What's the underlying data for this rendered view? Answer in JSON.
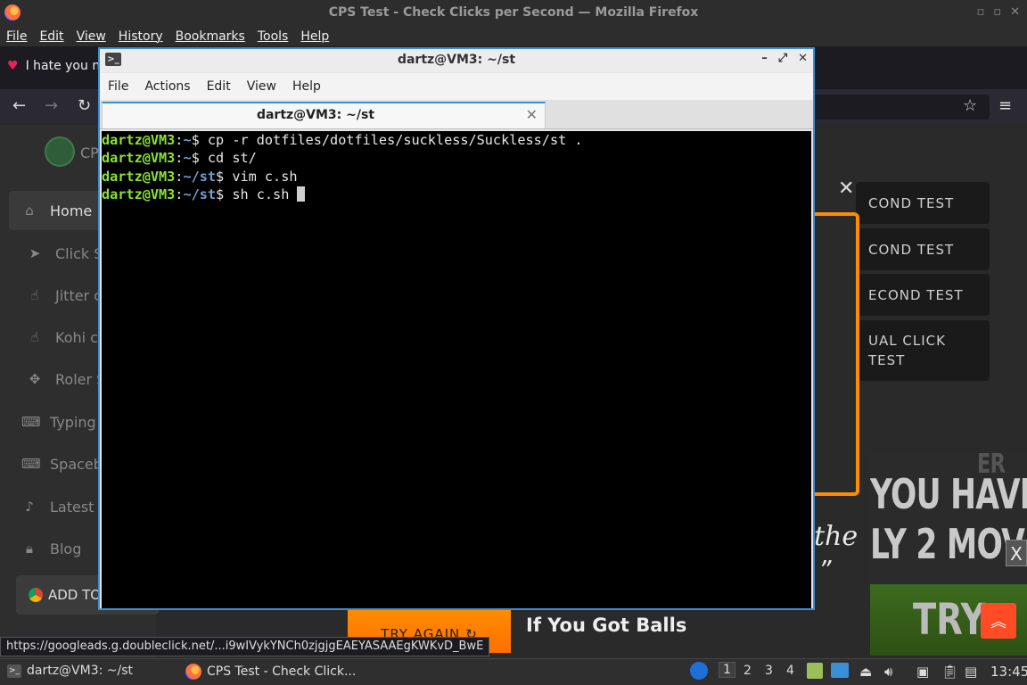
{
  "firefox": {
    "window_title": "CPS Test - Check Clicks per Second — Mozilla Firefox",
    "menu": [
      "File",
      "Edit",
      "View",
      "History",
      "Bookmarks",
      "Tools",
      "Help"
    ],
    "tab_label": "I hate you n"
  },
  "site": {
    "logo_text": "CP",
    "sidebar": [
      {
        "label": "Home",
        "icon": "home-icon"
      },
      {
        "label": "Click S",
        "icon": "cursor-icon"
      },
      {
        "label": "Jitter c",
        "icon": "hand-icon"
      },
      {
        "label": "Kohi c",
        "icon": "hand-icon"
      },
      {
        "label": "Roler S",
        "icon": "move-icon"
      },
      {
        "label": "Typing",
        "icon": "keyboard-icon"
      },
      {
        "label": "Spaceb",
        "icon": "keyboard-icon"
      },
      {
        "label": "Latest",
        "icon": "bell-icon"
      },
      {
        "label": "Blog",
        "icon": "lock-icon"
      }
    ],
    "add_to_label": "ADD TO",
    "test_buttons": [
      "COND TEST",
      "COND TEST",
      "ECOND TEST",
      "UAL CLICK",
      "TEST"
    ],
    "ad_big_lines": [
      "YOU HAVE",
      "LY 2 MOV"
    ],
    "ad_top_fragment": "ER",
    "the_text": "the",
    "quote_mark": "”",
    "ad_try_text": "TRY",
    "try_again_label": "TRY AGAIN",
    "balls_text": "If You Got Balls",
    "status_url": "https://googleads.g.doubleclick.net/...i9wIVykYNCh0zjgjgEAEYASAAEgKWKvD_BwE"
  },
  "terminal": {
    "title": "dartz@VM3: ~/st",
    "menu": [
      "File",
      "Actions",
      "Edit",
      "View",
      "Help"
    ],
    "tab_label": "dartz@VM3: ~/st",
    "lines": [
      {
        "user": "dartz@VM3",
        "sep": ":",
        "path": "~",
        "prompt": "$ ",
        "cmd": "cp -r dotfiles/dotfiles/suckless/Suckless/st ."
      },
      {
        "user": "dartz@VM3",
        "sep": ":",
        "path": "~",
        "prompt": "$ ",
        "cmd": "cd st/"
      },
      {
        "user": "dartz@VM3",
        "sep": ":",
        "path": "~/st",
        "prompt": "$ ",
        "cmd": "vim c.sh"
      },
      {
        "user": "dartz@VM3",
        "sep": ":",
        "path": "~/st",
        "prompt": "$ ",
        "cmd": "sh c.sh "
      }
    ]
  },
  "taskbar": {
    "tasks": [
      "dartz@VM3: ~/st",
      "CPS Test - Check Click..."
    ],
    "workspaces": [
      "1",
      "2",
      "3",
      "4"
    ],
    "active_workspace": "1",
    "clock": "13:45"
  }
}
